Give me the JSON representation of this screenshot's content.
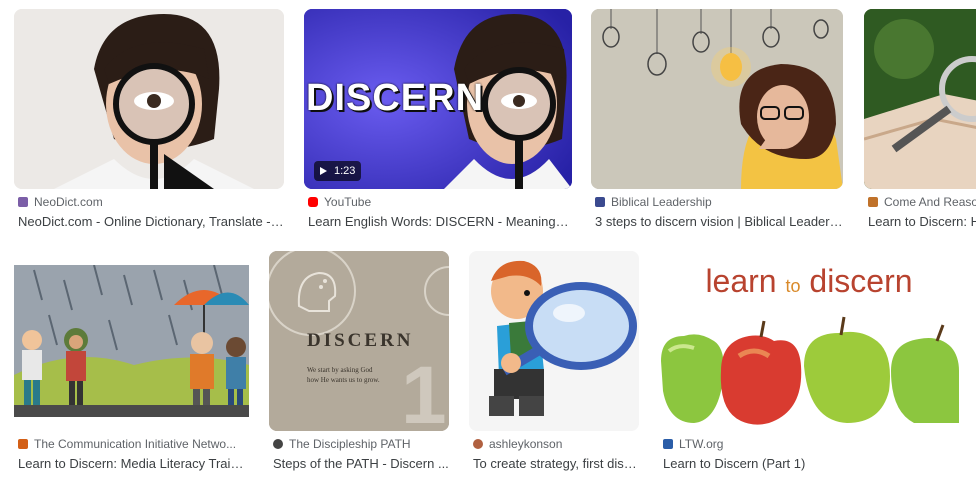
{
  "results": [
    {
      "source": "NeoDict.com",
      "title": "NeoDict.com - Online Dictionary, Translate - di...",
      "favicon_color": "#7b5ea7"
    },
    {
      "source": "YouTube",
      "title": "Learn English Words: DISCERN - Meaning, Vo...",
      "favicon_color": "#ff0000",
      "thumb_text": "DISCERN",
      "duration": "1:23"
    },
    {
      "source": "Biblical Leadership",
      "title": "3 steps to discern vision | Biblical Leaders...",
      "favicon_color": "#3b4a8f"
    },
    {
      "source": "Come And Reaso",
      "title": "Learn to Discern: Ho",
      "favicon_color": "#c0722a"
    },
    {
      "source": "The Communication Initiative Netwo...",
      "title": "Learn to Discern: Media Literacy Trainer...",
      "favicon_color": "#d35f16"
    },
    {
      "source": "The Discipleship PATH",
      "title": "Steps of the PATH - Discern ...",
      "favicon_color": "#444444",
      "thumb_text": "DISCERN",
      "thumb_subtext_1": "We start by asking God",
      "thumb_subtext_2": "how He wants us to grow.",
      "thumb_number": "1"
    },
    {
      "source": "ashleykonson",
      "title": "To create strategy, first disc...",
      "favicon_color": "#b06040"
    },
    {
      "source": "LTW.org",
      "title": "Learn to Discern (Part 1)",
      "favicon_color": "#2a5da8",
      "thumb_text_1": "learn",
      "thumb_text_2": "to",
      "thumb_text_3": "discern"
    }
  ]
}
